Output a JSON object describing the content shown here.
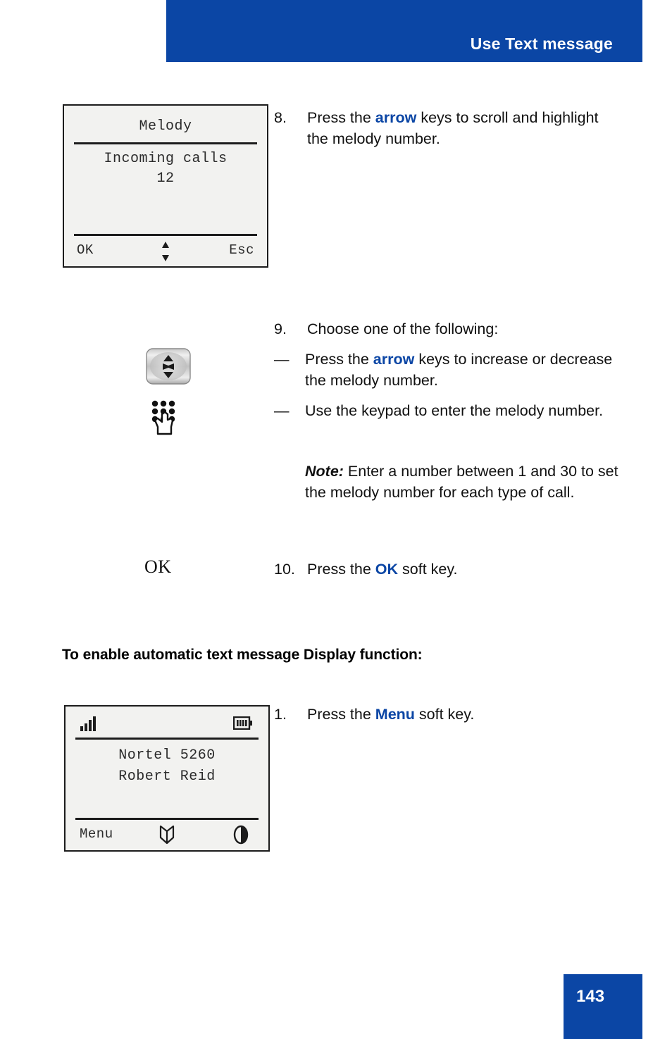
{
  "header": {
    "title": "Use Text message",
    "band_color": "#0b46a5"
  },
  "screens": {
    "melody": {
      "title": "Melody",
      "line1": "Incoming calls",
      "line2": "12",
      "soft_left": "OK",
      "soft_right": "Esc",
      "scroll_icon": "up-down-arrows-icon"
    },
    "idle": {
      "line1": "Nortel 5260",
      "line2": "Robert Reid",
      "soft_left": "Menu",
      "signal_icon": "signal-strength-icon",
      "battery_icon": "battery-icon",
      "directory_icon": "directory-book-icon",
      "contrast_icon": "contrast-icon"
    }
  },
  "key_art": {
    "nav_key": "navigation-key-icon",
    "keypad": "keypad-hand-icon",
    "ok_key_label": "OK"
  },
  "steps": {
    "step8": {
      "number": "8.",
      "text_before": "Press the ",
      "keyword": "arrow",
      "text_after": " keys to scroll and highlight the melody number."
    },
    "step9": {
      "number": "9.",
      "lead": "Choose one of the following:",
      "dash": "—",
      "bullet1_before": "Press the ",
      "bullet1_keyword": "arrow",
      "bullet1_after": " keys to increase or decrease the melody number.",
      "bullet2": "Use the keypad to enter the melody number."
    },
    "note": {
      "lead": "Note:",
      "text": " Enter a number between 1 and 30 to set the melody number for each type of call."
    },
    "step10": {
      "number": "10.",
      "text_before": "Press the ",
      "keyword": "OK",
      "text_after": " soft key."
    },
    "step1": {
      "number": "1.",
      "text_before": "Press the ",
      "keyword": "Menu",
      "text_after": " soft key."
    }
  },
  "section_heading": "To enable automatic text message Display function:",
  "footer": {
    "page_number": "143",
    "band_color": "#0b46a5"
  }
}
